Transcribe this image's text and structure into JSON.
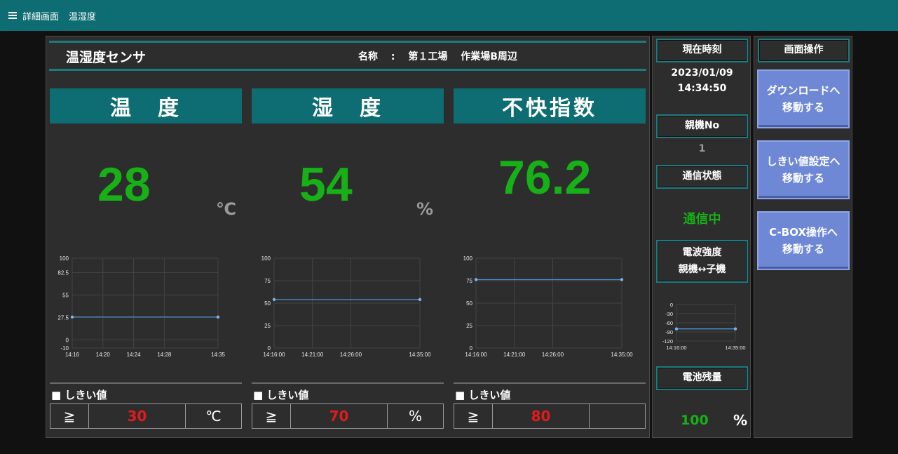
{
  "header": {
    "crumbs": [
      "詳細画面",
      "温湿度"
    ]
  },
  "sensor": {
    "title": "温湿度センサ",
    "name": "名称 　:　 第１工場 　作業場B周辺"
  },
  "columns": [
    {
      "title": "温　度",
      "value": "28",
      "unit": "℃",
      "threshold_label": "■ しきい値",
      "threshold_op": "≧",
      "threshold_value": "30",
      "threshold_unit": "℃"
    },
    {
      "title": "湿　度",
      "value": "54",
      "unit": "%",
      "threshold_label": "■ しきい値",
      "threshold_op": "≧",
      "threshold_value": "70",
      "threshold_unit": "%"
    },
    {
      "title": "不快指数",
      "value": "76.2",
      "unit": "",
      "threshold_label": "■ しきい値",
      "threshold_op": "≧",
      "threshold_value": "80",
      "threshold_unit": ""
    }
  ],
  "status": {
    "time_label": "現在時刻",
    "date": "2023/01/09",
    "time": "14:34:50",
    "parent_label": "親機No",
    "parent_no": "1",
    "comm_label": "通信状態",
    "comm_value": "通信中",
    "signal_label_1": "電波強度",
    "signal_label_2": "親機↔子機",
    "battery_label": "電池残量",
    "battery_value": "100",
    "battery_unit": "%"
  },
  "ops": {
    "title": "画面操作",
    "buttons": [
      {
        "line1": "ダウンロードへ",
        "line2": "移動する"
      },
      {
        "line1": "しきい値設定へ",
        "line2": "移動する"
      },
      {
        "line1": "C-BOX操作へ",
        "line2": "移動する"
      }
    ]
  },
  "colors": {
    "accent": "#0e6d72",
    "value_green": "#17b017",
    "threshold_red": "#e01b1b",
    "button_blue": "#6f88d6",
    "line": "#4e8fd1"
  },
  "chart_data": [
    {
      "type": "line",
      "x": [
        "14:16",
        "14:35"
      ],
      "xticks": [
        "14:16",
        "14:20",
        "14:24",
        "14:28",
        "14:35"
      ],
      "yticks": [
        -10,
        0,
        27.5,
        55,
        82.5,
        100
      ],
      "ylim": [
        -10,
        100
      ],
      "series": [
        {
          "values": [
            28,
            28
          ]
        }
      ]
    },
    {
      "type": "line",
      "x": [
        "14:16:00",
        "14:35:00"
      ],
      "xticks": [
        "14:16:00",
        "14:21:00",
        "14:26:00",
        "14:35:00"
      ],
      "yticks": [
        0,
        25,
        50,
        75,
        100
      ],
      "ylim": [
        0,
        100
      ],
      "series": [
        {
          "values": [
            54,
            54
          ]
        }
      ]
    },
    {
      "type": "line",
      "x": [
        "14:16:00",
        "14:35:00"
      ],
      "xticks": [
        "14:16:00",
        "14:21:00",
        "14:26:00",
        "14:35:00"
      ],
      "yticks": [
        0,
        25,
        50,
        75,
        100
      ],
      "ylim": [
        0,
        100
      ],
      "series": [
        {
          "values": [
            76.2,
            76.2
          ]
        }
      ]
    },
    {
      "type": "line",
      "x": [
        "14:16:00",
        "14:35:00"
      ],
      "xticks": [
        "14:16:00",
        "14:35:00"
      ],
      "yticks": [
        0,
        -30,
        -60,
        -90,
        -120
      ],
      "ylim": [
        -120,
        0
      ],
      "series": [
        {
          "values": [
            -80,
            -80
          ]
        }
      ]
    }
  ]
}
